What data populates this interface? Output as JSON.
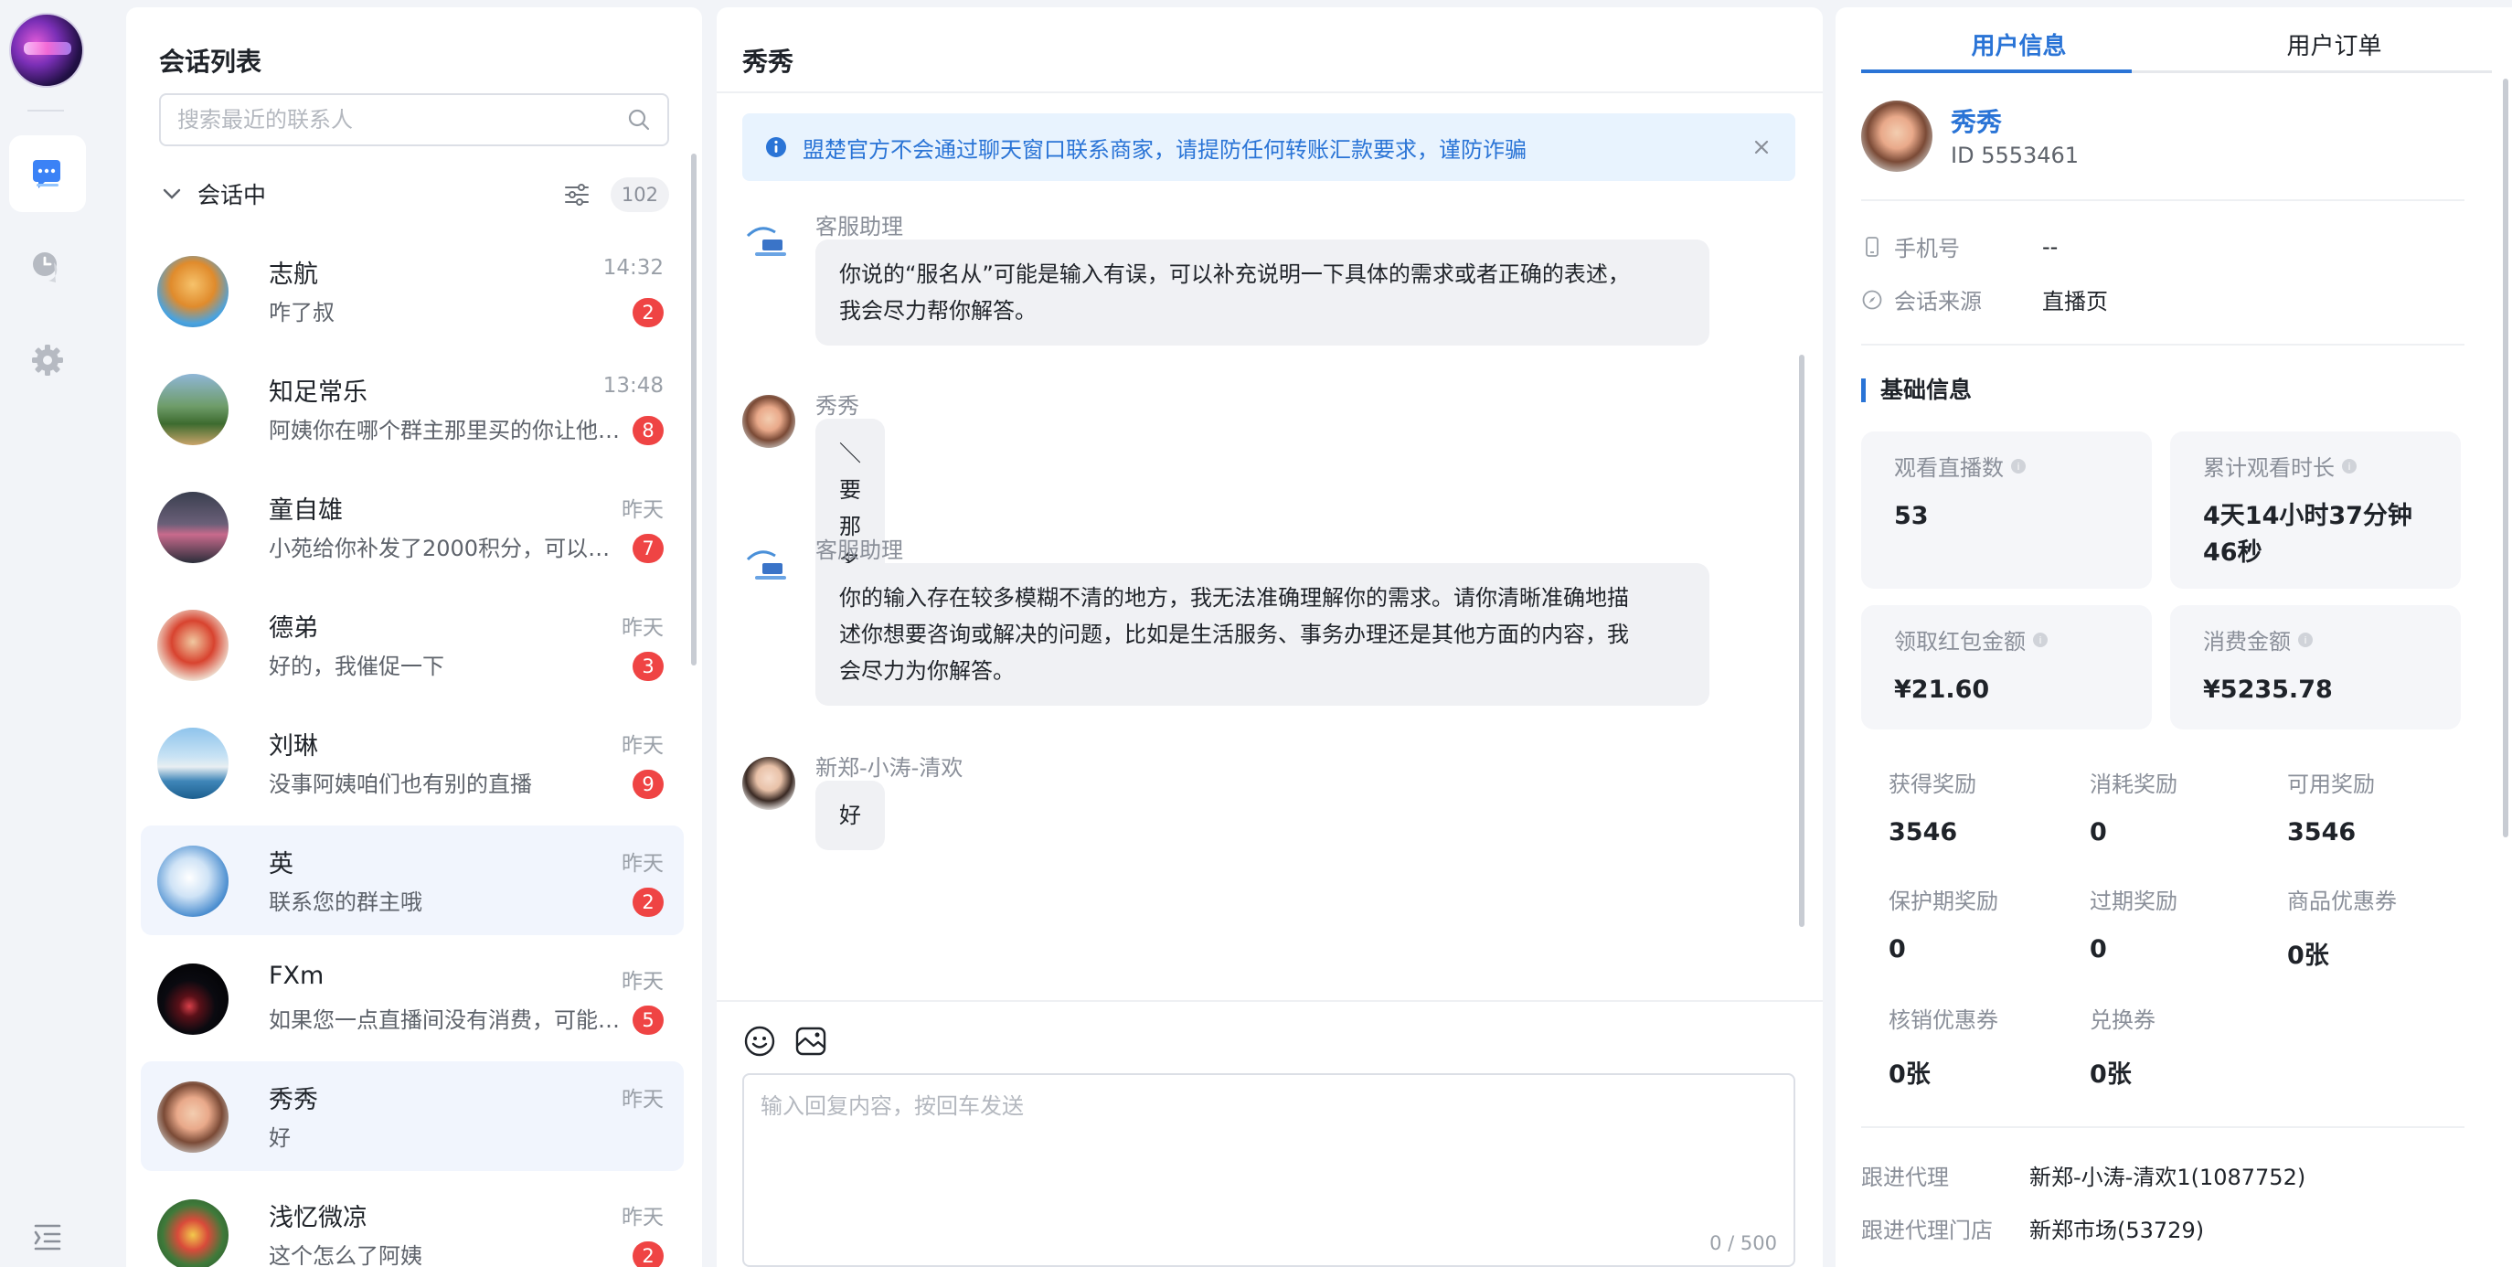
{
  "conversations": {
    "title": "会话列表",
    "search_placeholder": "搜索最近的联系人",
    "section_label": "会话中",
    "section_count": "102",
    "items": [
      {
        "name": "志航",
        "time": "14:32",
        "preview": "咋了叔",
        "badge": "2"
      },
      {
        "name": "知足常乐",
        "time": "13:48",
        "preview": "阿姨你在哪个群主那里买的你让他…",
        "badge": "8"
      },
      {
        "name": "童自雄",
        "time": "昨天",
        "preview": "小苑给你补发了2000积分，可以…",
        "badge": "7"
      },
      {
        "name": "德弟",
        "time": "昨天",
        "preview": "好的，我催促一下",
        "badge": "3"
      },
      {
        "name": "刘琳",
        "time": "昨天",
        "preview": "没事阿姨咱们也有别的直播",
        "badge": "9"
      },
      {
        "name": "英",
        "time": "昨天",
        "preview": "联系您的群主哦",
        "badge": "2"
      },
      {
        "name": "FXm",
        "time": "昨天",
        "preview": "如果您一点直播间没有消费，可能…",
        "badge": "5"
      },
      {
        "name": "秀秀",
        "time": "昨天",
        "preview": "好",
        "badge": ""
      },
      {
        "name": "浅忆微凉",
        "time": "昨天",
        "preview": "这个怎么了阿姨",
        "badge": "2"
      }
    ]
  },
  "chat": {
    "title": "秀秀",
    "notice": "盟楚官方不会通过聊天窗口联系商家，请提防任何转账汇款要求，谨防诈骗",
    "messages": [
      {
        "sender": "客服助理",
        "lines": [
          "你说的“服名从”可能是输入有误，可以补充说明一下具体的需求或者正确的表述，",
          "我会尽力帮你解答。"
        ]
      },
      {
        "sender": "秀秀",
        "lines": [
          "＼要那名要油"
        ]
      },
      {
        "sender": "客服助理",
        "lines": [
          "你的输入存在较多模糊不清的地方，我无法准确理解你的需求。请你清晰准确地描",
          "述你想要咨询或解决的问题，比如是生活服务、事务办理还是其他方面的内容，我",
          "会尽力为你解答。"
        ]
      },
      {
        "sender": "新郑-小涛-清欢",
        "lines": [
          "好"
        ]
      }
    ],
    "input_placeholder": "输入回复内容，按回车发送",
    "counter": "0 / 500"
  },
  "user_panel": {
    "tab_info": "用户信息",
    "tab_orders": "用户订单",
    "name": "秀秀",
    "id_text": "ID 5553461",
    "phone_label": "手机号",
    "phone_value": "--",
    "source_label": "会话来源",
    "source_value": "直播页",
    "basic_title": "基础信息",
    "cards": [
      {
        "label": "观看直播数",
        "value": "53"
      },
      {
        "label": "累计观看时长",
        "value": "4天14小时37分钟46秒"
      },
      {
        "label": "领取红包金额",
        "value": "¥21.60"
      },
      {
        "label": "消费金额",
        "value": "¥5235.78"
      }
    ],
    "stats": [
      {
        "label": "获得奖励",
        "value": "3546"
      },
      {
        "label": "消耗奖励",
        "value": "0"
      },
      {
        "label": "可用奖励",
        "value": "3546"
      },
      {
        "label": "保护期奖励",
        "value": "0"
      },
      {
        "label": "过期奖励",
        "value": "0"
      },
      {
        "label": "商品优惠券",
        "value": "0张"
      },
      {
        "label": "核销优惠券",
        "value": "0张"
      },
      {
        "label": "兑换券",
        "value": "0张"
      }
    ],
    "agent_label": "跟进代理",
    "agent_value": "新郑-小涛-清欢1(1087752)",
    "store_label": "跟进代理门店",
    "store_value": "新郑市场(53729)"
  },
  "colors": {
    "accent": "#2a74d6",
    "badge": "#ef4444",
    "notice_bg": "#e8f3fe"
  }
}
